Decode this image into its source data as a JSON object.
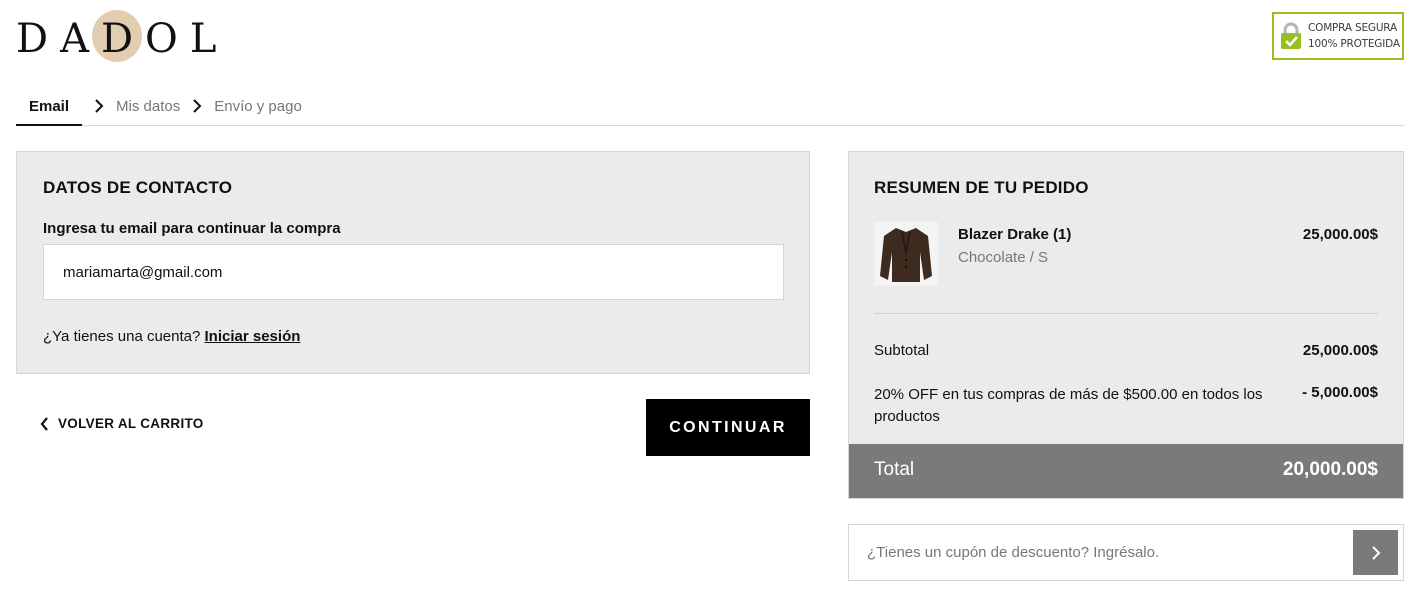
{
  "brand": {
    "logo_text": "DADOL",
    "accent_circle": "#e2cdb0"
  },
  "secure_badge": {
    "line1": "COMPRA SEGURA",
    "line2": "100% PROTEGIDA",
    "border_color": "#97c01f",
    "icon": "lock-check-icon"
  },
  "steps": [
    {
      "label": "Email",
      "active": true
    },
    {
      "label": "Mis datos",
      "active": false
    },
    {
      "label": "Envío y pago",
      "active": false
    }
  ],
  "contact": {
    "title": "DATOS DE CONTACTO",
    "email_label": "Ingresa tu email para continuar la compra",
    "email_value": "mariamarta@gmail.com",
    "account_prompt": "¿Ya tienes una cuenta?",
    "login_link": "Iniciar sesión"
  },
  "actions": {
    "back_label": "VOLVER AL CARRITO",
    "continue_label": "CONTINUAR"
  },
  "summary": {
    "title": "RESUMEN DE TU PEDIDO",
    "product": {
      "name": "Blazer Drake (1)",
      "variant": "Chocolate / S",
      "price": "25,000.00$",
      "image_icon": "blazer-image"
    },
    "subtotal_label": "Subtotal",
    "subtotal_value": "25,000.00$",
    "discount_label": "20% OFF en tus compras de más de $500.00 en todos los productos",
    "discount_value": "- 5,000.00$",
    "total_label": "Total",
    "total_value": "20,000.00$"
  },
  "coupon": {
    "placeholder": "¿Tienes un cupón de descuento? Ingrésalo.",
    "button_icon": "chevron-right-icon"
  }
}
